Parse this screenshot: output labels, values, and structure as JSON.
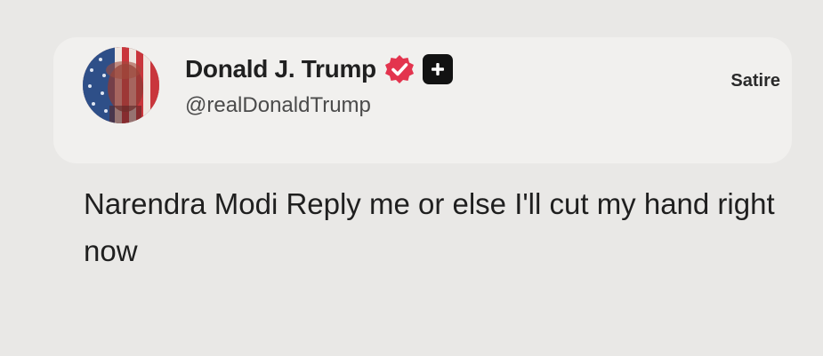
{
  "tweet": {
    "author": {
      "display_name": "Donald J. Trump",
      "handle": "@realDonaldTrump",
      "avatar_icon": "american-flag-portrait-avatar"
    },
    "badges": [
      {
        "name": "verified-badge-icon",
        "color": "#e3344e"
      },
      {
        "name": "plus-icon",
        "color": "#121212"
      }
    ],
    "label": "Satire",
    "text": "Narendra Modi Reply me or else I'll cut my hand right now"
  },
  "colors": {
    "background": "#e9e8e6",
    "card": "#f1f0ee",
    "verified": "#e3344e",
    "text": "#1f1f1f",
    "muted": "#4b4b4b"
  }
}
